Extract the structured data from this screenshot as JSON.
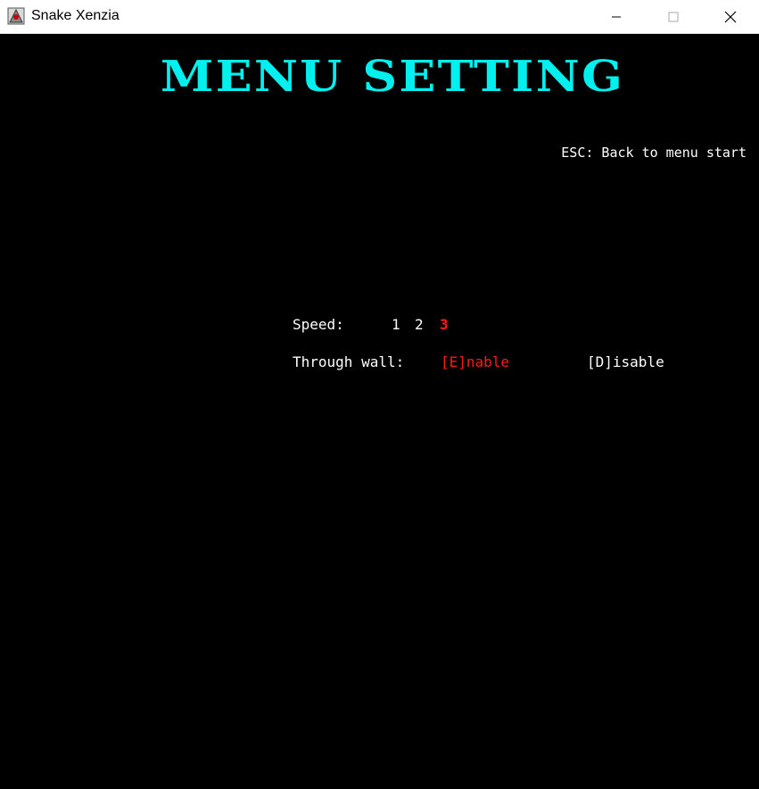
{
  "window": {
    "title": "Snake Xenzia",
    "controls": {
      "minimize_icon": "minimize-icon",
      "maximize_icon": "maximize-icon",
      "close_icon": "close-icon"
    }
  },
  "game": {
    "heading": "MENU SETTING",
    "esc_hint": "ESC: Back to menu start",
    "speed": {
      "label": "Speed:",
      "options": [
        "1",
        "2",
        "3"
      ],
      "selected": "3"
    },
    "through_wall": {
      "label": "Through wall:",
      "enable": "[E]nable",
      "disable": "[D]isable",
      "selected": "enable"
    },
    "colors": {
      "background": "#000000",
      "heading": "#00f0f0",
      "text": "#ffffff",
      "selected": "#ff1a1a"
    }
  }
}
